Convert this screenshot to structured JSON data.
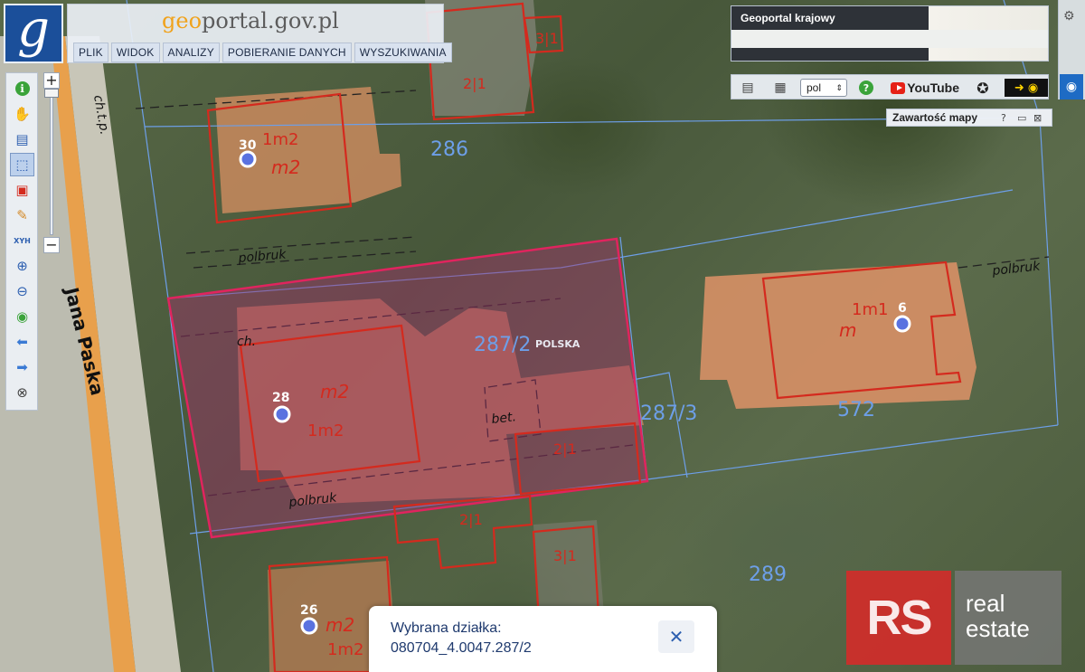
{
  "brand": {
    "logo_letter": "g",
    "title_geo": "geo",
    "title_rest": "portal.gov.pl"
  },
  "menu": [
    {
      "label": "PLIK"
    },
    {
      "label": "WIDOK"
    },
    {
      "label": "ANALIZY"
    },
    {
      "label": "POBIERANIE DANYCH"
    },
    {
      "label": "WYSZUKIWANIA"
    }
  ],
  "toolbar": {
    "tools": [
      {
        "name": "info-icon",
        "glyph": "ℹ"
      },
      {
        "name": "pan-hand-icon",
        "glyph": "✋"
      },
      {
        "name": "legend-icon",
        "glyph": "▤"
      },
      {
        "name": "select-rectangle-icon",
        "glyph": "⬚"
      },
      {
        "name": "select-area-icon",
        "glyph": "▣"
      },
      {
        "name": "pencil-icon",
        "glyph": "✎"
      },
      {
        "name": "xyh-icon",
        "glyph": "XYH"
      },
      {
        "name": "zoom-in-icon",
        "glyph": "⊕"
      },
      {
        "name": "zoom-out-icon",
        "glyph": "⊖"
      },
      {
        "name": "globe-icon",
        "glyph": "◉"
      },
      {
        "name": "back-arrow-icon",
        "glyph": "⬅"
      },
      {
        "name": "forward-arrow-icon",
        "glyph": "➡"
      },
      {
        "name": "compass-icon",
        "glyph": "⊗"
      }
    ],
    "zoom_plus": "+",
    "zoom_minus": "−"
  },
  "overview": {
    "label": "Geoportal krajowy"
  },
  "right_toolbar": {
    "language": "pol",
    "youtube_label": "YouTube"
  },
  "content_panel": {
    "title": "Zawartość mapy",
    "help": "?"
  },
  "map": {
    "street_name": "Jana Paska",
    "parcels": [
      "286",
      "287/2",
      "287/3",
      "572",
      "289"
    ],
    "address_points": [
      "30",
      "28",
      "6",
      "26"
    ],
    "building_labels": {
      "b30": [
        "1m2",
        "m2"
      ],
      "b28": [
        "m2",
        "1m2"
      ],
      "b6": [
        "1m1",
        "m"
      ],
      "b26": [
        "m2",
        "1m2"
      ],
      "small": [
        "3|1",
        "2|1",
        "2|1",
        "2|1",
        "3|1"
      ]
    },
    "other_labels": [
      "polbruk",
      "polbruk",
      "polbruk",
      "ch.",
      "ch.t.p.",
      "bet.",
      "POLSKA"
    ]
  },
  "parcel_info": {
    "label": "Wybrana działka:",
    "id": "080704_4.0047.287/2",
    "close": "✕"
  },
  "watermark": {
    "rs": "RS",
    "line1": "real",
    "line2": "estate"
  },
  "colors": {
    "parcel_highlight": "#e0245e",
    "building_outline": "#d42a1e",
    "parcel_line": "#6d9fe8",
    "brand_blue": "#1b4f9a"
  }
}
